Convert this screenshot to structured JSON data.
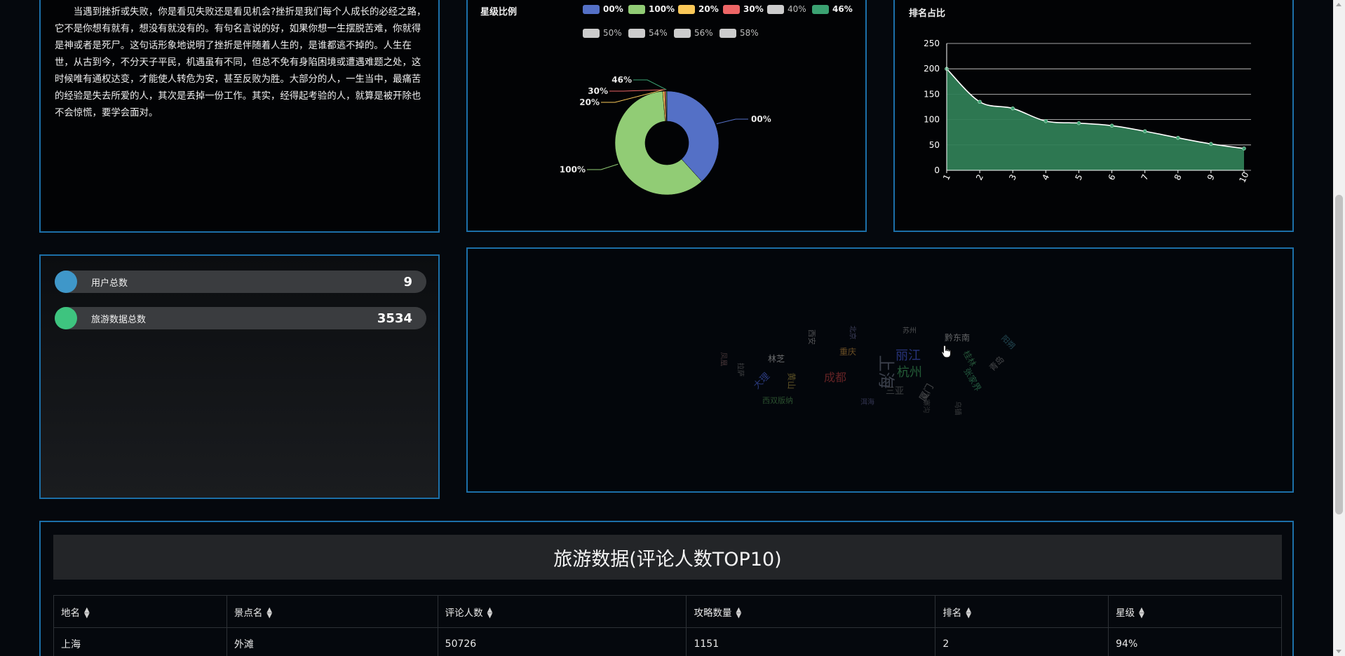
{
  "essay": {
    "text": "当遇到挫折或失败，你是看见失败还是看见机会?挫折是我们每个人成长的必经之路，它不是你想有就有，想没有就没有的。有句名言说的好，如果你想一生摆脱苦难，你就得是神或者是死尸。这句话形象地说明了挫折是伴随着人生的，是谁都逃不掉的。人生在世，从古到今，不分天子平民，机遇虽有不同，但总不免有身陷困境或遭遇难题之处，这时候唯有通权达变，才能使人转危为安，甚至反败为胜。大部分的人，一生当中，最痛苦的经验是失去所爱的人，其次是丢掉一份工作。其实，经得起考验的人，就算是被开除也不会惊慌，要学会面对。"
  },
  "pie": {
    "title": "星级比例",
    "legend": [
      {
        "label": "00%",
        "color": "#5470c6"
      },
      {
        "label": "100%",
        "color": "#91cc75"
      },
      {
        "label": "20%",
        "color": "#fac858"
      },
      {
        "label": "30%",
        "color": "#ee6666"
      },
      {
        "label": "40%",
        "color": "#cccccc"
      },
      {
        "label": "46%",
        "color": "#3ba272"
      },
      {
        "label": "50%",
        "color": "#cccccc"
      },
      {
        "label": "54%",
        "color": "#cccccc"
      },
      {
        "label": "56%",
        "color": "#cccccc"
      },
      {
        "label": "58%",
        "color": "#cccccc"
      }
    ]
  },
  "area": {
    "title": "排名占比"
  },
  "stats": {
    "items": [
      {
        "label": "用户总数",
        "value": "9",
        "color": "#3f97c9"
      },
      {
        "label": "旅游数据总数",
        "value": "3534",
        "color": "#3ec47f"
      }
    ]
  },
  "cloud": {
    "words": [
      {
        "text": "丽江",
        "color": "#4658d6"
      },
      {
        "text": "杭州",
        "color": "#3ea05a"
      },
      {
        "text": "成都",
        "color": "#b23a3a"
      },
      {
        "text": "上海",
        "color": "#6a7080"
      },
      {
        "text": "黔东南",
        "color": "#b0b0b0"
      },
      {
        "text": "林芝",
        "color": "#c0c0c0"
      },
      {
        "text": "大理",
        "color": "#4a64d8"
      },
      {
        "text": "三亚",
        "color": "#6a6a6a"
      },
      {
        "text": "厦门",
        "color": "#808080"
      },
      {
        "text": "桂林",
        "color": "#3e8e5a"
      },
      {
        "text": "西安",
        "color": "#8f8f8f"
      },
      {
        "text": "黄山",
        "color": "#a08a3a"
      },
      {
        "text": "青岛",
        "color": "#7a7a7a"
      },
      {
        "text": "张家界",
        "color": "#3e9e6a"
      },
      {
        "text": "苏州",
        "color": "#8a8a8a"
      },
      {
        "text": "拉萨",
        "color": "#707070"
      },
      {
        "text": "重庆",
        "color": "#c08a3a"
      },
      {
        "text": "北京",
        "color": "#6a6a9a"
      },
      {
        "text": "九寨沟",
        "color": "#5a5a5a"
      },
      {
        "text": "阳朔",
        "color": "#3e7e8e"
      },
      {
        "text": "乌镇",
        "color": "#6a6a6a"
      },
      {
        "text": "凤凰",
        "color": "#7a5a5a"
      },
      {
        "text": "西双版纳",
        "color": "#4a8a4a"
      },
      {
        "text": "洱海",
        "color": "#5a5a8a"
      }
    ]
  },
  "table": {
    "title": "旅游数据(评论人数TOP10)",
    "columns": [
      "地名",
      "景点名",
      "评论人数",
      "攻略数量",
      "排名",
      "星级"
    ],
    "rows": [
      [
        "上海",
        "外滩",
        "50726",
        "1151",
        "2",
        "94%"
      ]
    ]
  },
  "chart_data": [
    {
      "type": "pie",
      "title": "星级比例",
      "slices": [
        {
          "label": "00%",
          "value": 38,
          "color": "#5470c6"
        },
        {
          "label": "100%",
          "value": 60,
          "color": "#91cc75"
        },
        {
          "label": "20%",
          "value": 0.6,
          "color": "#fac858"
        },
        {
          "label": "30%",
          "value": 0.4,
          "color": "#ee6666"
        },
        {
          "label": "46%",
          "value": 0.3,
          "color": "#3ba272"
        }
      ],
      "inner_radius_ratio": 0.42,
      "legend_position": "top"
    },
    {
      "type": "area",
      "title": "排名占比",
      "x": [
        "1",
        "2",
        "3",
        "4",
        "5",
        "6",
        "7",
        "8",
        "9",
        "10"
      ],
      "values": [
        200,
        135,
        122,
        97,
        93,
        88,
        77,
        64,
        52,
        43
      ],
      "ylim": [
        0,
        250
      ],
      "yticks": [
        0,
        50,
        100,
        150,
        200,
        250
      ],
      "fill_color": "#2f7d55",
      "line_color": "#ffffff",
      "grid": true
    }
  ]
}
